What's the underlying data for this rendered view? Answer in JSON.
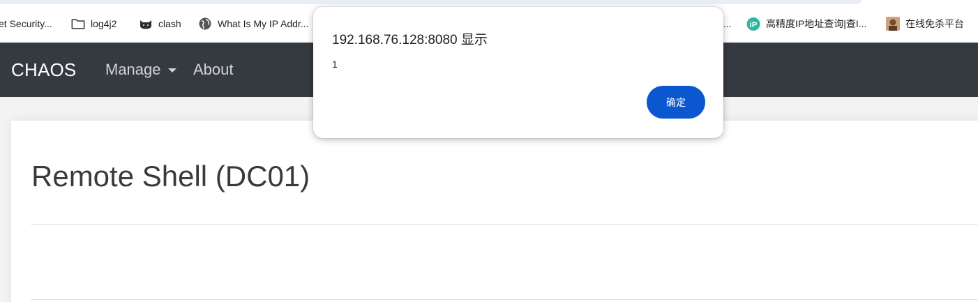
{
  "bookmarks": [
    {
      "label": "et Security...",
      "icon": "none"
    },
    {
      "label": "log4j2",
      "icon": "folder-icon"
    },
    {
      "label": "clash",
      "icon": "cat-icon"
    },
    {
      "label": "What Is My IP Addr...",
      "icon": "globe-icon"
    },
    {
      "label": "...",
      "icon": "none"
    },
    {
      "label": "高精度IP地址查询|查I...",
      "icon": "ip-icon"
    },
    {
      "label": "在线免杀平台",
      "icon": "avatar-icon"
    }
  ],
  "navbar": {
    "brand": "CHAOS",
    "manage": "Manage",
    "about": "About"
  },
  "main": {
    "title": "Remote Shell (DC01)"
  },
  "dialog": {
    "title": "192.168.76.128:8080 显示",
    "message": "1",
    "ok_label": "确定"
  },
  "colors": {
    "navbar_bg": "#343a40",
    "dialog_button": "#0b57d0",
    "ip_icon": "#2fb8a0"
  }
}
